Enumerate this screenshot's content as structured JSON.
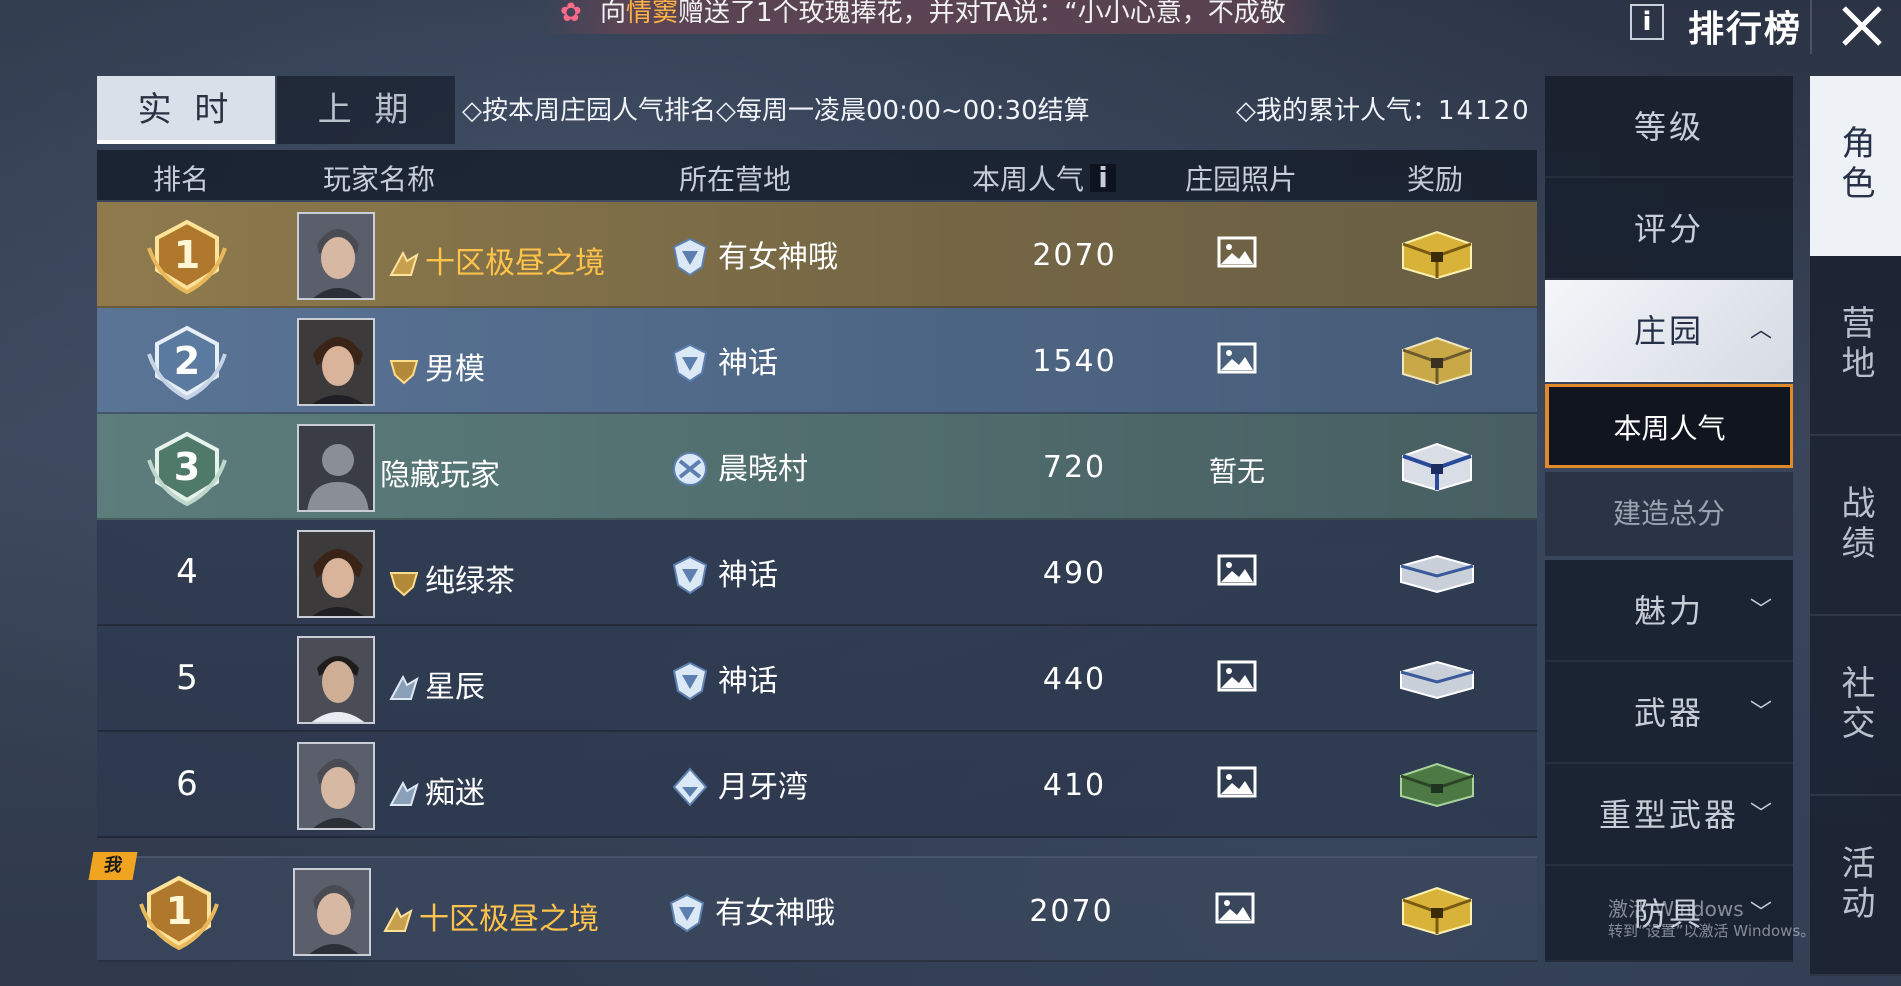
{
  "ticker": {
    "prefix": "向",
    "highlight": "情窦",
    "text": "赠送了1个玫瑰捧花，并对TA说：“小小心意，不成敬"
  },
  "header": {
    "info_label": "i",
    "title": "排行榜"
  },
  "tabs": {
    "live": "实 时",
    "previous": "上 期"
  },
  "rules": {
    "rule_text": "◇按本周庄园人气排名◇每周一凌晨00:00~00:30结算",
    "my_total_label": "◇我的累计人气：",
    "my_total_value": "14120"
  },
  "table": {
    "headers": {
      "rank": "排名",
      "player": "玩家名称",
      "camp": "所在营地",
      "popularity": "本周人气",
      "popularity_info": "i",
      "photo": "庄园照片",
      "reward": "奖励"
    },
    "rows": [
      {
        "rank": "1",
        "name": "十区极昼之境",
        "camp": "有女神哦",
        "popularity": "2070",
        "photo": "image",
        "reward": "gold-chest"
      },
      {
        "rank": "2",
        "name": "男模",
        "camp": "神话",
        "popularity": "1540",
        "photo": "image",
        "reward": "gold-chest"
      },
      {
        "rank": "3",
        "name": "隐藏玩家",
        "camp": "晨晓村",
        "popularity": "720",
        "photo": "暂无",
        "reward": "blue-chest"
      },
      {
        "rank": "4",
        "name": "纯绿茶",
        "camp": "神话",
        "popularity": "490",
        "photo": "image",
        "reward": "silver-chest"
      },
      {
        "rank": "5",
        "name": "星辰",
        "camp": "神话",
        "popularity": "440",
        "photo": "image",
        "reward": "silver-chest"
      },
      {
        "rank": "6",
        "name": "痴迷",
        "camp": "月牙湾",
        "popularity": "410",
        "photo": "image",
        "reward": "green-chest"
      }
    ],
    "me": {
      "tag": "我",
      "rank": "1",
      "name": "十区极昼之境",
      "camp": "有女神哦",
      "popularity": "2070",
      "photo": "image",
      "reward": "gold-chest"
    }
  },
  "categories": {
    "level": "等级",
    "score": "评分",
    "manor": "庄园",
    "manor_subs": {
      "weekly": "本周人气",
      "build": "建造总分"
    },
    "charm": "魅力",
    "weapon": "武器",
    "heavy": "重型武器",
    "armor": "防具"
  },
  "side_tabs": [
    "角色",
    "营地",
    "战绩",
    "社交",
    "活动"
  ],
  "watermark": {
    "line1": "激活 Windows",
    "line2": "转到“设置”以激活 Windows。"
  },
  "colors": {
    "gold_name": "#ffc24a",
    "orange_border": "#e08a28"
  }
}
